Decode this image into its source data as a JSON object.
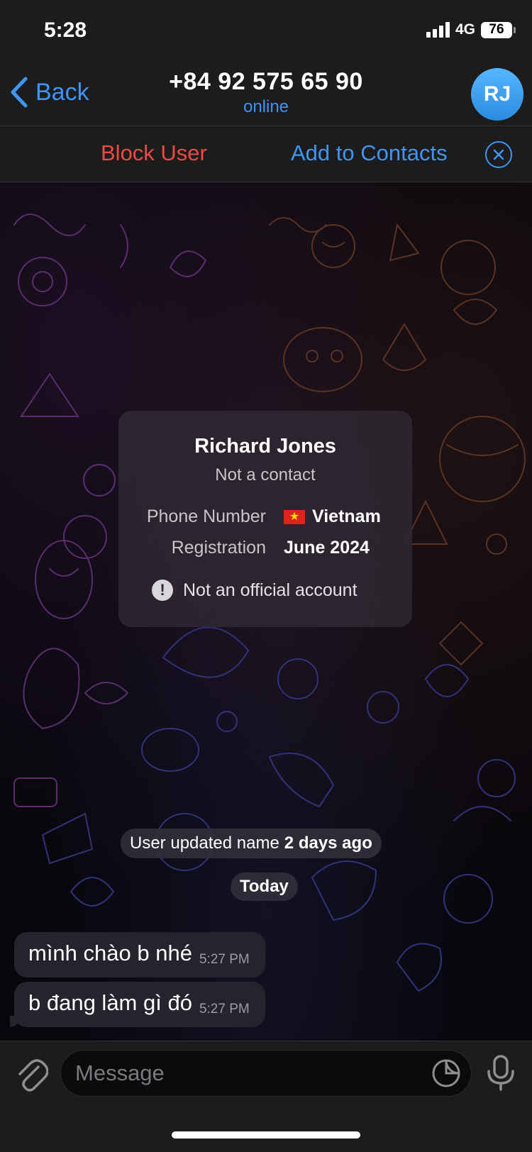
{
  "status_bar": {
    "time": "5:28",
    "network": "4G",
    "battery": "76"
  },
  "header": {
    "back_label": "Back",
    "title": "+84 92 575 65 90",
    "subtitle": "online",
    "avatar_initials": "RJ"
  },
  "action_bar": {
    "block_label": "Block User",
    "add_label": "Add to Contacts"
  },
  "info_card": {
    "name": "Richard Jones",
    "subtitle": "Not a contact",
    "phone_label": "Phone Number",
    "phone_value": "Vietnam",
    "registration_label": "Registration",
    "registration_value": "June 2024",
    "warning": "Not an official account"
  },
  "service_message": {
    "text": "User updated name",
    "emphasis": "2 days ago"
  },
  "date_separator": "Today",
  "messages": [
    {
      "text": "mình chào b nhé",
      "time": "5:27 PM"
    },
    {
      "text": "b đang làm gì đó",
      "time": "5:27 PM"
    }
  ],
  "input": {
    "placeholder": "Message"
  },
  "colors": {
    "accent": "#3e95f5",
    "danger": "#ec4a44",
    "bubble": "#26222e",
    "bar": "#1c1c1d"
  }
}
